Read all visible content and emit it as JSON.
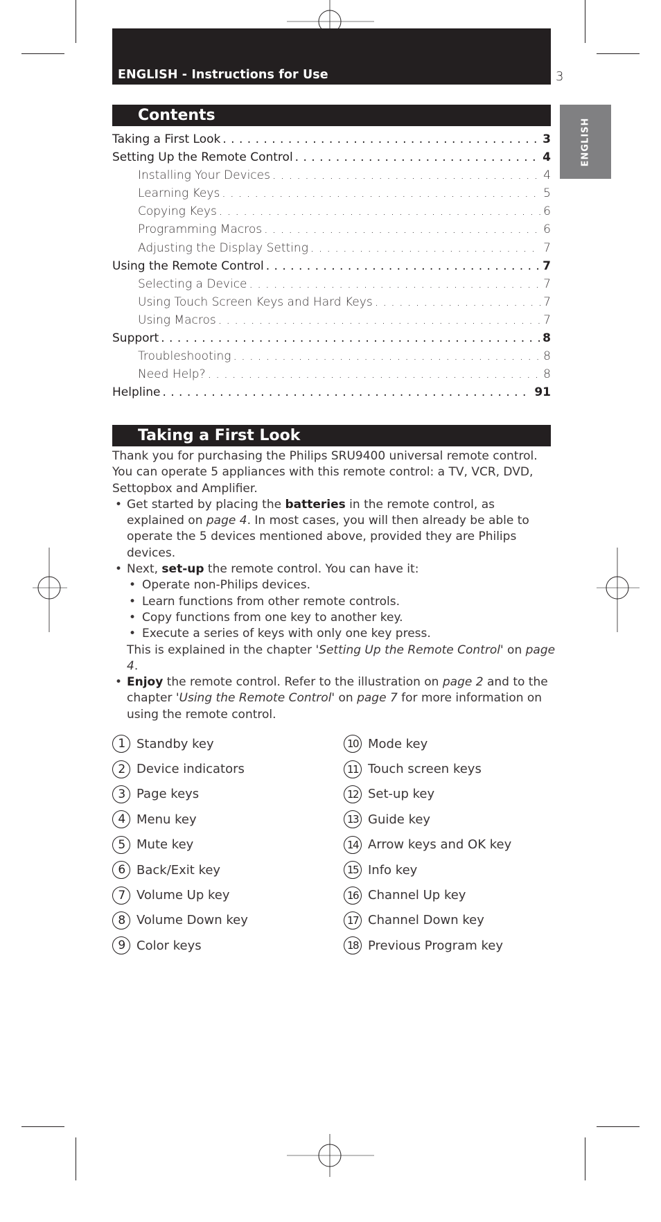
{
  "header": {
    "title": "ENGLISH - Instructions for Use",
    "page_number": "3",
    "language_tab": "ENGLISH"
  },
  "contents": {
    "title": "Contents",
    "items": [
      {
        "label": "Taking a First Look",
        "page": "3",
        "level": 1
      },
      {
        "label": "Setting Up the Remote Control",
        "page": "4",
        "level": 1
      },
      {
        "label": "Installing Your Devices",
        "page": "4",
        "level": 2
      },
      {
        "label": "Learning Keys",
        "page": "5",
        "level": 2
      },
      {
        "label": "Copying Keys",
        "page": "6",
        "level": 2
      },
      {
        "label": "Programming Macros",
        "page": "6",
        "level": 2
      },
      {
        "label": "Adjusting the Display Setting",
        "page": "7",
        "level": 2
      },
      {
        "label": "Using the Remote Control",
        "page": "7",
        "level": 1
      },
      {
        "label": "Selecting a Device",
        "page": "7",
        "level": 2
      },
      {
        "label": "Using Touch Screen Keys and Hard Keys",
        "page": "7",
        "level": 2
      },
      {
        "label": "Using Macros",
        "page": "7",
        "level": 2
      },
      {
        "label": "Support",
        "page": "8",
        "level": 1
      },
      {
        "label": "Troubleshooting",
        "page": "8",
        "level": 2
      },
      {
        "label": "Need Help?",
        "page": "8",
        "level": 2
      },
      {
        "label": "Helpline",
        "page": "91",
        "level": 1
      }
    ]
  },
  "first_look": {
    "title": "Taking a First Look",
    "intro": "Thank you for purchasing the Philips SRU9400 universal remote control. You can operate 5 appliances with this remote control: a TV, VCR, DVD, Settopbox and Amplifier.",
    "bullet1": {
      "pre": "Get started by placing the ",
      "bold": "batteries",
      "mid": " in the remote control, as explained on ",
      "ref": "page 4",
      "post": ". In most cases, you will then already be able to operate the 5 devices mentioned above, provided they are Philips devices."
    },
    "bullet2": {
      "pre": "Next, ",
      "bold": "set-up",
      "post": " the remote control. You can have it:",
      "subitems": [
        "Operate non-Philips devices.",
        "Learn functions from other remote controls.",
        "Copy functions from one key to another key.",
        "Execute a series of keys with only one key press."
      ],
      "note_pre": "This is explained in the chapter ",
      "note_chapter": "'Setting Up the Remote Control'",
      "note_mid": " on ",
      "note_ref": "page 4",
      "note_post": "."
    },
    "bullet3": {
      "bold": "Enjoy",
      "pre": " the remote control. Refer to the illustration on ",
      "ref1": "page 2",
      "mid": " and to the chapter ",
      "chapter": "'Using the Remote Control'",
      "mid2": " on ",
      "ref2": "page 7",
      "post": " for more information on using the remote control."
    }
  },
  "keys": [
    {
      "num": "1",
      "label": "Standby key"
    },
    {
      "num": "2",
      "label": "Device indicators"
    },
    {
      "num": "3",
      "label": "Page keys"
    },
    {
      "num": "4",
      "label": "Menu key"
    },
    {
      "num": "5",
      "label": "Mute key"
    },
    {
      "num": "6",
      "label": "Back/Exit key"
    },
    {
      "num": "7",
      "label": "Volume Up key"
    },
    {
      "num": "8",
      "label": "Volume Down key"
    },
    {
      "num": "9",
      "label": "Color keys"
    },
    {
      "num": "10",
      "label": "Mode key"
    },
    {
      "num": "11",
      "label": "Touch screen keys"
    },
    {
      "num": "12",
      "label": "Set-up key"
    },
    {
      "num": "13",
      "label": "Guide key"
    },
    {
      "num": "14",
      "label": "Arrow keys and OK key"
    },
    {
      "num": "15",
      "label": "Info key"
    },
    {
      "num": "16",
      "label": "Channel Up key"
    },
    {
      "num": "17",
      "label": "Channel Down key"
    },
    {
      "num": "18",
      "label": "Previous Program key"
    }
  ]
}
